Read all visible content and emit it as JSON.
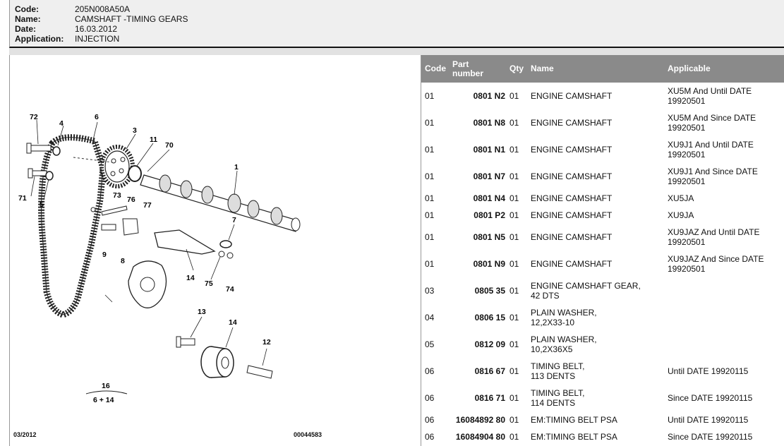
{
  "header": {
    "code_label": "Code:",
    "code": "205N008A50A",
    "name_label": "Name:",
    "name": "CAMSHAFT -TIMING GEARS",
    "date_label": "Date:",
    "date": "16.03.2012",
    "application_label": "Application:",
    "application": "INJECTION"
  },
  "diagram": {
    "date_code": "03/2012",
    "ref_number": "00044583",
    "callouts": [
      "72",
      "4",
      "6",
      "3",
      "11",
      "70",
      "1",
      "71",
      "5",
      "73",
      "76",
      "77",
      "7",
      "9",
      "8",
      "14",
      "75",
      "74",
      "13",
      "14",
      "12",
      "16",
      "6 + 14"
    ]
  },
  "table": {
    "columns": [
      {
        "key": "code",
        "line1": "Code",
        "line2": ""
      },
      {
        "key": "part",
        "line1": "Part",
        "line2": "number"
      },
      {
        "key": "qty",
        "line1": "Qty",
        "line2": ""
      },
      {
        "key": "name",
        "line1": "Name",
        "line2": ""
      },
      {
        "key": "applicable",
        "line1": "Applicable",
        "line2": ""
      }
    ],
    "rows": [
      {
        "code": "01",
        "part": "0801 N2",
        "qty": "01",
        "name1": "ENGINE CAMSHAFT",
        "name2": "",
        "app1": "XU5M And Until DATE",
        "app2": "19920501"
      },
      {
        "code": "01",
        "part": "0801 N8",
        "qty": "01",
        "name1": "ENGINE CAMSHAFT",
        "name2": "",
        "app1": "XU5M And Since DATE",
        "app2": "19920501"
      },
      {
        "code": "01",
        "part": "0801 N1",
        "qty": "01",
        "name1": "ENGINE CAMSHAFT",
        "name2": "",
        "app1": "XU9J1 And Until DATE",
        "app2": "19920501"
      },
      {
        "code": "01",
        "part": "0801 N7",
        "qty": "01",
        "name1": "ENGINE CAMSHAFT",
        "name2": "",
        "app1": "XU9J1 And Since DATE",
        "app2": "19920501"
      },
      {
        "code": "01",
        "part": "0801 N4",
        "qty": "01",
        "name1": "ENGINE CAMSHAFT",
        "name2": "",
        "app1": "XU5JA",
        "app2": ""
      },
      {
        "code": "01",
        "part": "0801 P2",
        "qty": "01",
        "name1": "ENGINE CAMSHAFT",
        "name2": "",
        "app1": "XU9JA",
        "app2": ""
      },
      {
        "code": "01",
        "part": "0801 N5",
        "qty": "01",
        "name1": "ENGINE CAMSHAFT",
        "name2": "",
        "app1": "XU9JAZ And Until DATE",
        "app2": "19920501"
      },
      {
        "code": "01",
        "part": "0801 N9",
        "qty": "01",
        "name1": "ENGINE CAMSHAFT",
        "name2": "",
        "app1": "XU9JAZ And Since DATE",
        "app2": "19920501"
      },
      {
        "code": "03",
        "part": "0805 35",
        "qty": "01",
        "name1": "ENGINE CAMSHAFT GEAR,",
        "name2": "42 DTS",
        "app1": "",
        "app2": ""
      },
      {
        "code": "04",
        "part": "0806 15",
        "qty": "01",
        "name1": "PLAIN WASHER,",
        "name2": "12,2X33-10",
        "app1": "",
        "app2": ""
      },
      {
        "code": "05",
        "part": "0812 09",
        "qty": "01",
        "name1": "PLAIN WASHER,",
        "name2": "10,2X36X5",
        "app1": "",
        "app2": ""
      },
      {
        "code": "06",
        "part": "0816 67",
        "qty": "01",
        "name1": "TIMING BELT,",
        "name2": "113 DENTS",
        "app1": "Until DATE 19920115",
        "app2": ""
      },
      {
        "code": "06",
        "part": "0816 71",
        "qty": "01",
        "name1": "TIMING BELT,",
        "name2": "114 DENTS",
        "app1": "Since DATE 19920115",
        "app2": ""
      },
      {
        "code": "06",
        "part": "16084892 80",
        "qty": "01",
        "name1": "EM:TIMING BELT PSA",
        "name2": "",
        "app1": "Until DATE 19920115",
        "app2": ""
      },
      {
        "code": "06",
        "part": "16084904 80",
        "qty": "01",
        "name1": "EM:TIMING BELT PSA",
        "name2": "",
        "app1": "Since DATE 19920115",
        "app2": ""
      }
    ]
  }
}
